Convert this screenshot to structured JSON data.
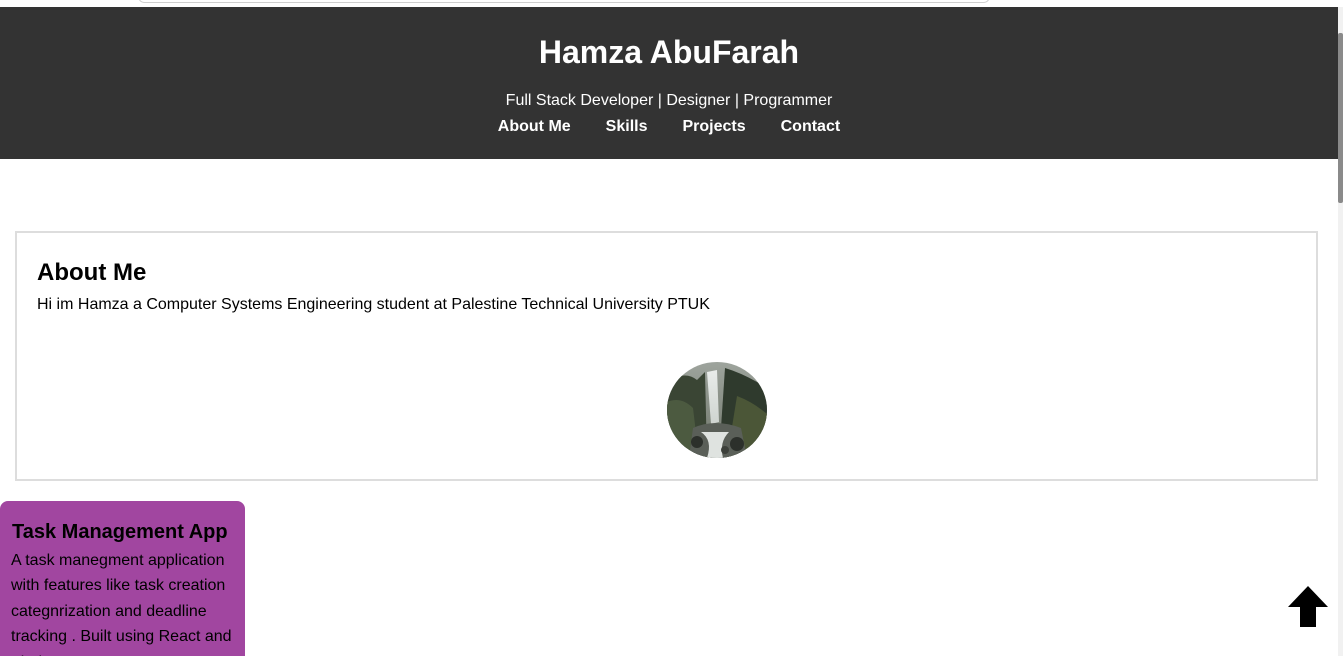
{
  "header": {
    "title": "Hamza AbuFarah",
    "tagline": "Full Stack Developer | Designer | Programmer",
    "nav": [
      "About Me",
      "Skills",
      "Projects",
      "Contact"
    ],
    "background": "#333333"
  },
  "about": {
    "heading": "About Me",
    "text": "Hi im Hamza a Computer Systems Engineering student at Palestine Technical University PTUK",
    "image": "waterfall-photo"
  },
  "project": {
    "title": "Task Management App",
    "description": "A task manegment application with features like task creation categnrization and deadline tracking . Built using React and Firebase",
    "background": "#a146a0"
  },
  "back_to_top": {
    "icon": "arrow-up-icon"
  }
}
